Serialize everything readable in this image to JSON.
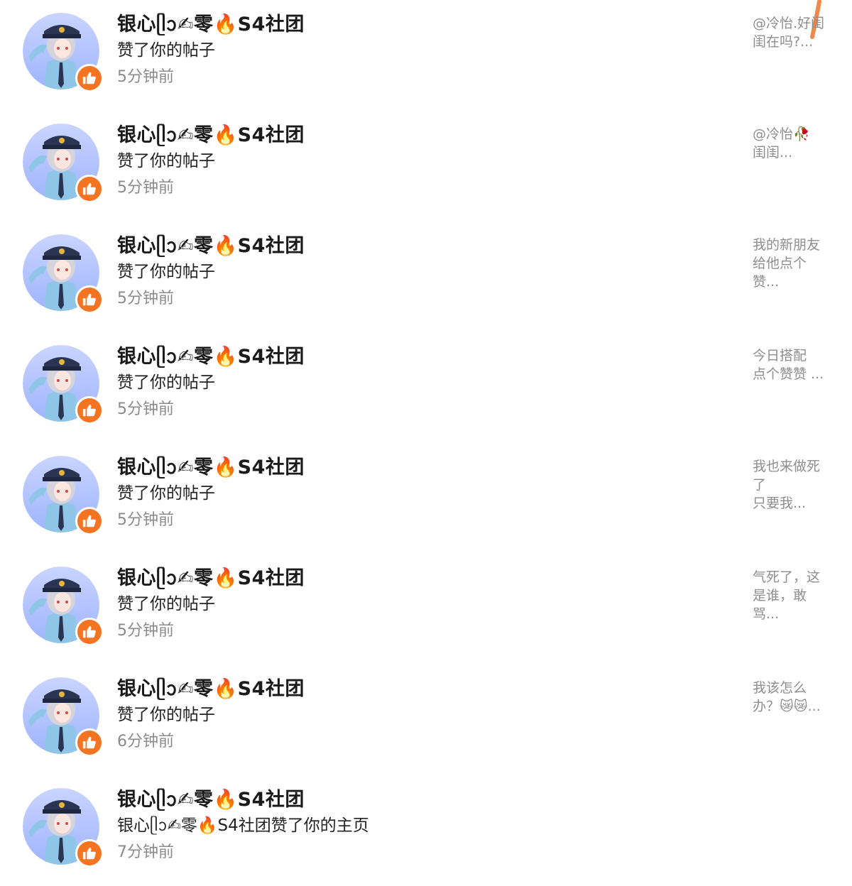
{
  "notifications": [
    {
      "user_name": "银心ᥫᩣ✍零🔥S4社团",
      "action": "赞了你的帖子",
      "time": "5分钟前",
      "preview": "@冷怡.好闺\n闺在吗?..."
    },
    {
      "user_name": "银心ᥫᩣ✍零🔥S4社团",
      "action": "赞了你的帖子",
      "time": "5分钟前",
      "preview": "@冷怡🥀\n闺闺..."
    },
    {
      "user_name": "银心ᥫᩣ✍零🔥S4社团",
      "action": "赞了你的帖子",
      "time": "5分钟前",
      "preview": "我的新朋友\n给他点个\n赞..."
    },
    {
      "user_name": "银心ᥫᩣ✍零🔥S4社团",
      "action": "赞了你的帖子",
      "time": "5分钟前",
      "preview": "今日搭配\n点个赞赞 ..."
    },
    {
      "user_name": "银心ᥫᩣ✍零🔥S4社团",
      "action": "赞了你的帖子",
      "time": "5分钟前",
      "preview": "我也来做死\n了\n只要我..."
    },
    {
      "user_name": "银心ᥫᩣ✍零🔥S4社团",
      "action": "赞了你的帖子",
      "time": "5分钟前",
      "preview": "气死了，这\n是谁，敢\n骂..."
    },
    {
      "user_name": "银心ᥫᩣ✍零🔥S4社团",
      "action": "赞了你的帖子",
      "time": "6分钟前",
      "preview": "我该怎么\n办？😿😿..."
    },
    {
      "user_name": "银心ᥫᩣ✍零🔥S4社团",
      "action": "银心ᥫᩣ✍零🔥S4社团赞了你的主页",
      "time": "7分钟前",
      "preview": ""
    }
  ],
  "icons": {
    "avatar": "avatar-icon",
    "like_badge": "thumbs-up-icon",
    "corner_mark": "orange-stroke-icon"
  },
  "colors": {
    "badge": "#f47421",
    "avatar_bg": "#b7c8ff",
    "name": "#1a1a1a",
    "time": "#8a8a8a",
    "preview": "#8e8e8e"
  }
}
